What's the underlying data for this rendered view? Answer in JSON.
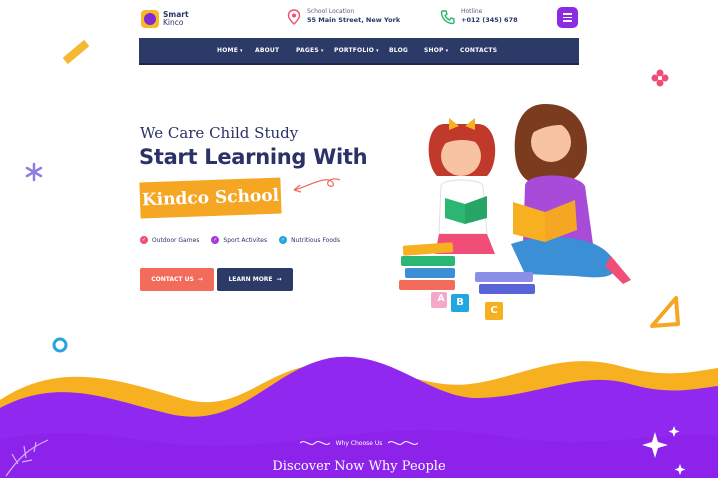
{
  "header": {
    "logo_line1": "Smart",
    "logo_line2": "Kinco",
    "location_label": "School Location",
    "location_value": "55 Main Street, New York",
    "hotline_label": "Hotline",
    "hotline_value": "+012 (345) 678"
  },
  "nav": {
    "items": [
      "HOME",
      "ABOUT",
      "PAGES",
      "PORTFOLIO",
      "BLOG",
      "SHOP",
      "CONTACTS"
    ]
  },
  "hero": {
    "tagline": "We Care Child Study",
    "title": "Start Learning With",
    "highlight": "Kindco School",
    "features": [
      "Outdoor Games",
      "Sport Activites",
      "Nutritious Foods"
    ],
    "btn_contact": "CONTACT US",
    "btn_learn": "LEARN MORE",
    "blocks": [
      "A",
      "B",
      "C"
    ]
  },
  "section": {
    "eyebrow": "Why Choose Us",
    "heading": "Discover Now Why People"
  },
  "colors": {
    "navy": "#2b3a67",
    "purple": "#8b2be2",
    "orange": "#f5a623",
    "coral": "#f26b5b"
  }
}
